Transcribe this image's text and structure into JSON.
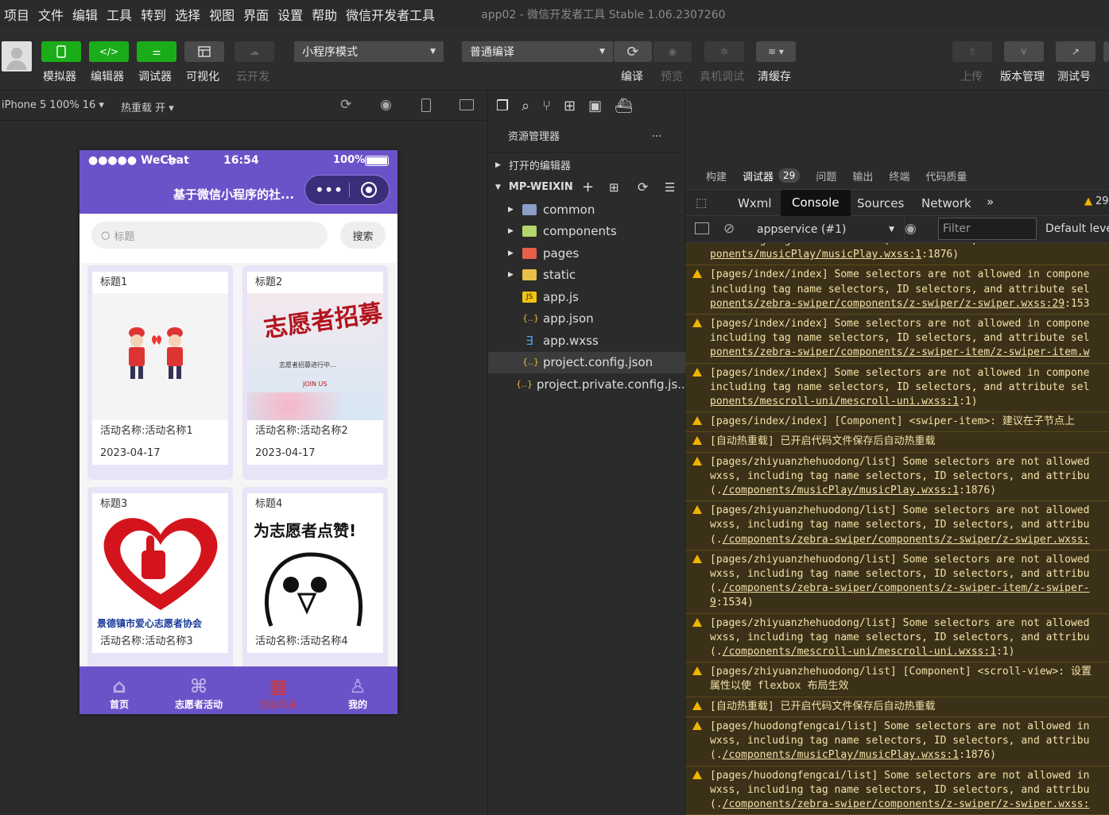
{
  "menu": [
    "项目",
    "文件",
    "编辑",
    "工具",
    "转到",
    "选择",
    "视图",
    "界面",
    "设置",
    "帮助",
    "微信开发者工具"
  ],
  "window_title": "app02 - 微信开发者工具 Stable 1.06.2307260",
  "toolbar": {
    "simulator": "模拟器",
    "editor": "编辑器",
    "debugger": "调试器",
    "visual": "可视化",
    "cloud": "云开发",
    "mode": "小程序模式",
    "compile_mode": "普通编译",
    "compile": "编译",
    "preview": "预览",
    "real_debug": "真机调试",
    "clear_cache": "清缓存",
    "upload": "上传",
    "version": "版本管理",
    "test": "测试号"
  },
  "simbar": {
    "device": "iPhone 5 100% 16 ▾",
    "hot_reload": "热重载 开 ▾"
  },
  "phone": {
    "carrier": "●●●●● WeChat",
    "time": "16:54",
    "battery": "100%",
    "nav_title": "基于微信小程序的社...",
    "search_placeholder": "标题",
    "search_button": "搜索",
    "cards": [
      {
        "title": "标题1",
        "name": "活动名称:活动名称1",
        "date": "2023-04-17"
      },
      {
        "title": "标题2",
        "name": "活动名称:活动名称2",
        "date": "2023-04-17"
      },
      {
        "title": "标题3",
        "name": "活动名称:活动名称3",
        "img_text": "景德镇市爱心志愿者协会"
      },
      {
        "title": "标题4",
        "name": "活动名称:活动名称4",
        "img_text": "为志愿者点赞!"
      }
    ],
    "card2_img_text": "志愿者招募",
    "card2_img_sub": "志愿者招募进行中...",
    "card2_img_tag": "JOIN US",
    "tabs": [
      "首页",
      "志愿者活动",
      "活动风采",
      "我的"
    ]
  },
  "explorer": {
    "title": "资源管理器",
    "open_editors": "打开的编辑器",
    "project": "MP-WEIXIN",
    "items": [
      {
        "name": "common",
        "type": "folder"
      },
      {
        "name": "components",
        "type": "folder"
      },
      {
        "name": "pages",
        "type": "folder"
      },
      {
        "name": "static",
        "type": "folder"
      },
      {
        "name": "app.js",
        "type": "js"
      },
      {
        "name": "app.json",
        "type": "json"
      },
      {
        "name": "app.wxss",
        "type": "wxss"
      },
      {
        "name": "project.config.json",
        "type": "json"
      },
      {
        "name": "project.private.config.js...",
        "type": "json"
      }
    ]
  },
  "devtools": {
    "top_tabs": [
      "构建",
      "调试器",
      "问题",
      "输出",
      "终端",
      "代码质量"
    ],
    "debugger_count": "29",
    "sub_tabs": [
      "Wxml",
      "Console",
      "Sources",
      "Network"
    ],
    "warn_count": "29",
    "context": "appservice (#1)",
    "filter_placeholder": "Filter",
    "level": "Default leve",
    "logs": [
      {
        "text": "including tag name selectors, ID selectors, and attribute sel",
        "link": "ponents/musicPlay/musicPlay.wxss:1",
        "tail": ":1876)",
        "partial": true
      },
      {
        "text": "[pages/index/index] Some selectors are not allowed in compone\nincluding tag name selectors, ID selectors, and attribute sel",
        "link": "ponents/zebra-swiper/components/z-swiper/z-swiper.wxss:29",
        "tail": ":153"
      },
      {
        "text": "[pages/index/index] Some selectors are not allowed in compone\nincluding tag name selectors, ID selectors, and attribute sel",
        "link": "ponents/zebra-swiper/components/z-swiper-item/z-swiper-item.w",
        "tail": ""
      },
      {
        "text": "[pages/index/index] Some selectors are not allowed in compone\nincluding tag name selectors, ID selectors, and attribute sel",
        "link": "ponents/mescroll-uni/mescroll-uni.wxss:1",
        "tail": ":1)"
      },
      {
        "text": "[pages/index/index] [Component] <swiper-item>: 建议在子节点上"
      },
      {
        "text": "[自动热重载] 已开启代码文件保存后自动热重载"
      },
      {
        "text": "[pages/zhiyuanzhehuodong/list] Some selectors are not allowed\nwxss, including tag name selectors, ID selectors, and attribu\n(.",
        "link": "/components/musicPlay/musicPlay.wxss:1",
        "tail": ":1876)"
      },
      {
        "text": "[pages/zhiyuanzhehuodong/list] Some selectors are not allowed\nwxss, including tag name selectors, ID selectors, and attribu\n(.",
        "link": "/components/zebra-swiper/components/z-swiper/z-swiper.wxss:",
        "tail": ""
      },
      {
        "text": "[pages/zhiyuanzhehuodong/list] Some selectors are not allowed\nwxss, including tag name selectors, ID selectors, and attribu\n(.",
        "link": "/components/zebra-swiper/components/z-swiper-item/z-swiper-\n9",
        "tail": ":1534)"
      },
      {
        "text": "[pages/zhiyuanzhehuodong/list] Some selectors are not allowed\nwxss, including tag name selectors, ID selectors, and attribu\n(.",
        "link": "/components/mescroll-uni/mescroll-uni.wxss:1",
        "tail": ":1)"
      },
      {
        "text": "[pages/zhiyuanzhehuodong/list] [Component] <scroll-view>: 设置\n属性以使 flexbox 布局生效"
      },
      {
        "text": "[自动热重载] 已开启代码文件保存后自动热重载"
      },
      {
        "text": "[pages/huodongfengcai/list] Some selectors are not allowed in\nwxss, including tag name selectors, ID selectors, and attribu\n(.",
        "link": "/components/musicPlay/musicPlay.wxss:1",
        "tail": ":1876)"
      },
      {
        "text": "[pages/huodongfengcai/list] Some selectors are not allowed in\nwxss, including tag name selectors, ID selectors, and attribu\n(.",
        "link": "/components/zebra-swiper/components/z-swiper/z-swiper.wxss:",
        "tail": ""
      }
    ]
  },
  "colors": {
    "accent_green": "#1aad19",
    "phone_theme": "#6b52c9",
    "warn_bg": "#3b3118",
    "warn_text": "#f2e1a8"
  }
}
